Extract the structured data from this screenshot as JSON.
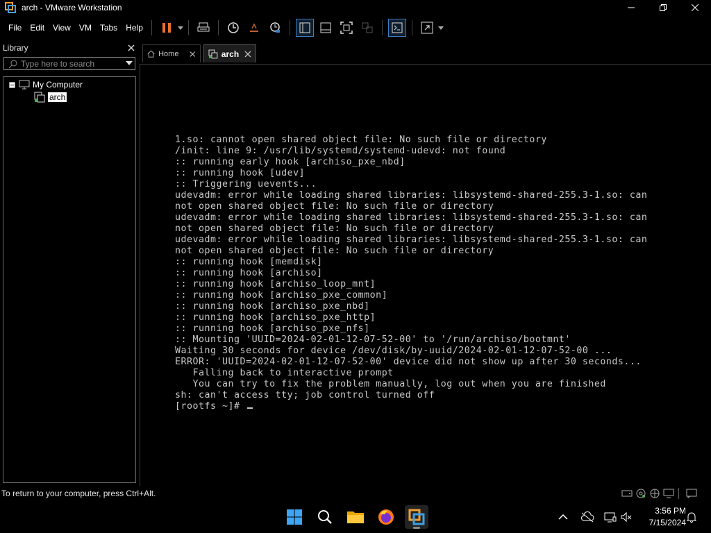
{
  "window": {
    "title": "arch - VMware Workstation"
  },
  "menu": {
    "items": [
      "File",
      "Edit",
      "View",
      "VM",
      "Tabs",
      "Help"
    ]
  },
  "library": {
    "title": "Library",
    "search_placeholder": "Type here to search",
    "tree": {
      "root_label": "My Computer",
      "child_label": "arch"
    }
  },
  "tabs": [
    {
      "label": "Home",
      "icon": "home-icon"
    },
    {
      "label": "arch",
      "icon": "vm-icon"
    }
  ],
  "console": {
    "lines": [
      "1.so: cannot open shared object file: No such file or directory",
      "/init: line 9: /usr/lib/systemd/systemd-udevd: not found",
      ":: running early hook [archiso_pxe_nbd]",
      ":: running hook [udev]",
      ":: Triggering uevents...",
      "udevadm: error while loading shared libraries: libsystemd-shared-255.3-1.so: can",
      "not open shared object file: No such file or directory",
      "udevadm: error while loading shared libraries: libsystemd-shared-255.3-1.so: can",
      "not open shared object file: No such file or directory",
      "udevadm: error while loading shared libraries: libsystemd-shared-255.3-1.so: can",
      "not open shared object file: No such file or directory",
      ":: running hook [memdisk]",
      ":: running hook [archiso]",
      ":: running hook [archiso_loop_mnt]",
      ":: running hook [archiso_pxe_common]",
      ":: running hook [archiso_pxe_nbd]",
      ":: running hook [archiso_pxe_http]",
      ":: running hook [archiso_pxe_nfs]",
      ":: Mounting 'UUID=2024-02-01-12-07-52-00' to '/run/archiso/bootmnt'",
      "Waiting 30 seconds for device /dev/disk/by-uuid/2024-02-01-12-07-52-00 ...",
      "ERROR: 'UUID=2024-02-01-12-07-52-00' device did not show up after 30 seconds...",
      "   Falling back to interactive prompt",
      "   You can try to fix the problem manually, log out when you are finished",
      "sh: can't access tty; job control turned off"
    ],
    "prompt": "[rootfs ~]# "
  },
  "statusbar": {
    "text": "To return to your computer, press Ctrl+Alt."
  },
  "taskbar": {
    "apps": [
      "start-icon",
      "search-icon",
      "file-explorer-icon",
      "firefox-icon",
      "vmware-icon"
    ],
    "clock_time": "3:56 PM",
    "clock_date": "7/15/2024"
  },
  "colors": {
    "background": "#000000",
    "console_text": "#c8c8c8",
    "accent_blue": "#3b7fc4",
    "pause_orange": "#e8702a"
  }
}
